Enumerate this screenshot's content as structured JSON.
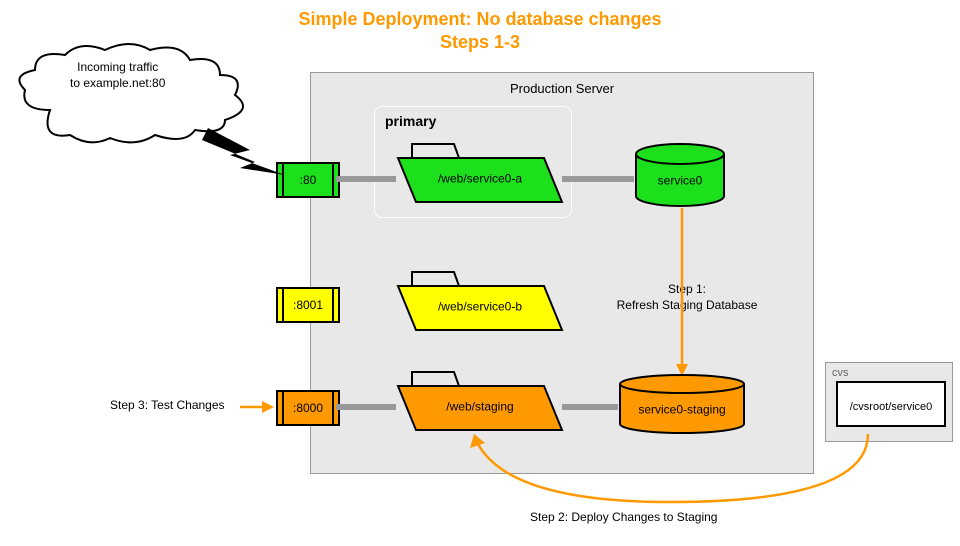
{
  "title": {
    "line1": "Simple Deployment: No database changes",
    "line2": "Steps 1-3"
  },
  "cloud": {
    "text1": "Incoming traffic",
    "text2": "to example.net:80"
  },
  "ports": {
    "p80": ":80",
    "p8001": ":8001",
    "p8000": ":8000"
  },
  "server": {
    "label": "Production Server",
    "primary": "primary"
  },
  "folders": {
    "a": "/web/service0-a",
    "b": "/web/service0-b",
    "staging": "/web/staging"
  },
  "databases": {
    "main": "service0",
    "staging": "service0-staging"
  },
  "cvs": {
    "label": "cvs",
    "path": "/cvsroot/service0"
  },
  "steps": {
    "s1a": "Step 1:",
    "s1b": "Refresh Staging Database",
    "s2": "Step 2: Deploy Changes to Staging",
    "s3": "Step 3: Test Changes"
  }
}
